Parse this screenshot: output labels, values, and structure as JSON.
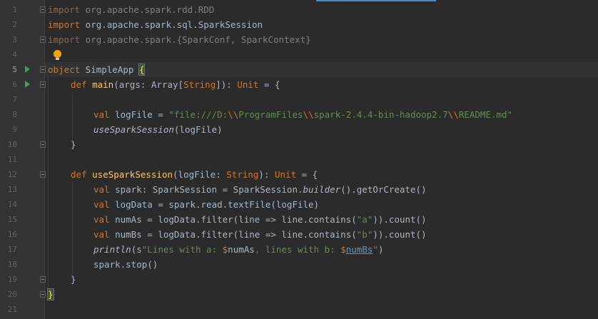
{
  "editor": {
    "lines": [
      {
        "no": "1",
        "text": "import org.apache.spark.rdd.RDD"
      },
      {
        "no": "2",
        "text": "import org.apache.spark.sql.SparkSession"
      },
      {
        "no": "3",
        "text": "import org.apache.spark.{SparkConf, SparkContext}"
      },
      {
        "no": "4",
        "text": ""
      },
      {
        "no": "5",
        "text": "object SimpleApp {"
      },
      {
        "no": "6",
        "text": "def main(args: Array[String]): Unit = {"
      },
      {
        "no": "7",
        "text": ""
      },
      {
        "no": "8",
        "text": "val logFile = \"file:///D:\\\\ProgramFiles\\\\spark-2.4.4-bin-hadoop2.7\\\\README.md\""
      },
      {
        "no": "9",
        "text": "useSparkSession(logFile)"
      },
      {
        "no": "10",
        "text": "}"
      },
      {
        "no": "11",
        "text": ""
      },
      {
        "no": "12",
        "text": "def useSparkSession(logFile: String): Unit = {"
      },
      {
        "no": "13",
        "text": "val spark: SparkSession = SparkSession.builder().getOrCreate()"
      },
      {
        "no": "14",
        "text": "val logData = spark.read.textFile(logFile)"
      },
      {
        "no": "15",
        "text": "val numAs = logData.filter(line => line.contains(\"a\")).count()"
      },
      {
        "no": "16",
        "text": "val numBs = logData.filter(line => line.contains(\"b\")).count()"
      },
      {
        "no": "17",
        "text": "println(s\"Lines with a: $numAs, lines with b: $numBs\")"
      },
      {
        "no": "18",
        "text": "spark.stop()"
      },
      {
        "no": "19",
        "text": "}"
      },
      {
        "no": "20",
        "text": "}"
      },
      {
        "no": "21",
        "text": ""
      }
    ],
    "current_line": "5",
    "gutter_icons": {
      "run": "run-icon",
      "fold": "fold-icon",
      "hint": "lightbulb-icon"
    },
    "colors": {
      "background": "#2b2b2b",
      "keyword": "#cc7832",
      "function": "#ffc66d",
      "string": "#6a8759",
      "text": "#a9b7c6",
      "run_icon": "#499c54"
    }
  }
}
